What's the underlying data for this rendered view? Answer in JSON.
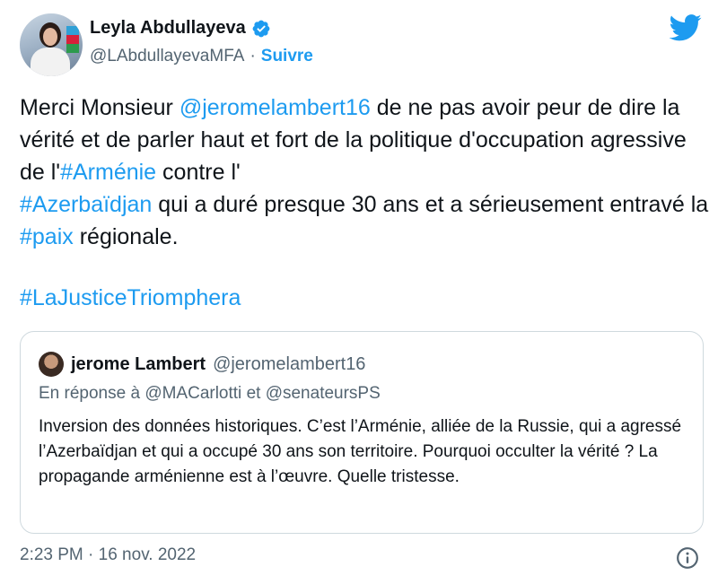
{
  "author": {
    "name": "Leyla Abdullayeva",
    "handle": "@LAbdullayevaMFA",
    "separator": "·",
    "follow_label": "Suivre"
  },
  "icons": {
    "verified": "verified-badge-icon",
    "bird": "twitter-bird-icon",
    "info": "info-icon",
    "accent_color": "#1d9bf0"
  },
  "tweet": {
    "t1": "Merci Monsieur ",
    "m1": "@jeromelambert16",
    "t2": " de ne pas avoir peur de dire la vérité et de parler haut et fort de la politique d'occupation agressive de l'",
    "h1": "#Arménie",
    "t3": " contre l'",
    "h2": "#Azerbaïdjan",
    "t4": " qui a duré presque 30 ans et a sérieusement entravé la ",
    "h3": "#paix",
    "t5": " régionale.",
    "hashtag_line": "#LaJusticeTriomphera"
  },
  "quote": {
    "name": "jerome Lambert",
    "handle": "@jeromelambert16",
    "reply_prefix": "En réponse à ",
    "reply_to_1": "@MACarlotti",
    "reply_and": " et ",
    "reply_to_2": "@senateursPS",
    "text": "Inversion des données historiques. C’est l’Arménie, alliée de la Russie, qui a agressé l’Azerbaïdjan et qui a occupé 30 ans son territoire. Pourquoi occulter la vérité ? La propagande arménienne est à l’œuvre. Quelle tristesse."
  },
  "footer": {
    "timestamp": "2:23 PM · 16 nov. 2022"
  }
}
